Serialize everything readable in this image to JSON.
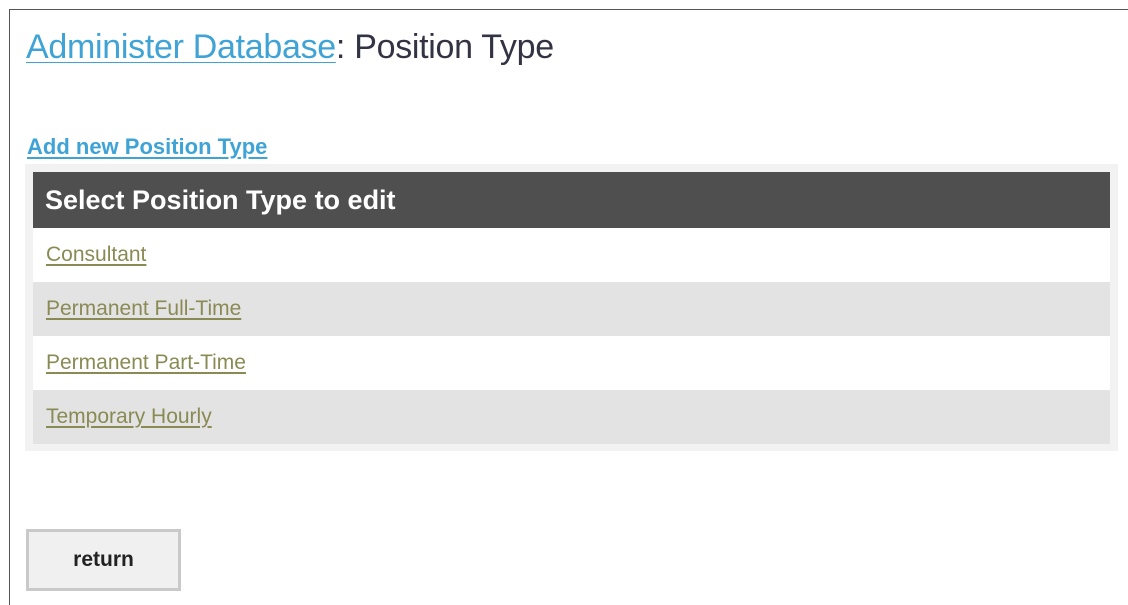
{
  "header": {
    "breadcrumb_link": "Administer Database",
    "separator": ":",
    "title": "Position Type"
  },
  "add_link": "Add new Position Type",
  "list": {
    "header": "Select Position Type to edit",
    "items": [
      {
        "label": "Consultant"
      },
      {
        "label": "Permanent Full-Time"
      },
      {
        "label": "Permanent Part-Time"
      },
      {
        "label": "Temporary Hourly"
      }
    ]
  },
  "return_button": "return",
  "colors": {
    "link": "#3fa3d6",
    "header_bg": "#4f4f4f",
    "row_link": "#8a8a55",
    "row_alt": "#e3e3e3"
  }
}
